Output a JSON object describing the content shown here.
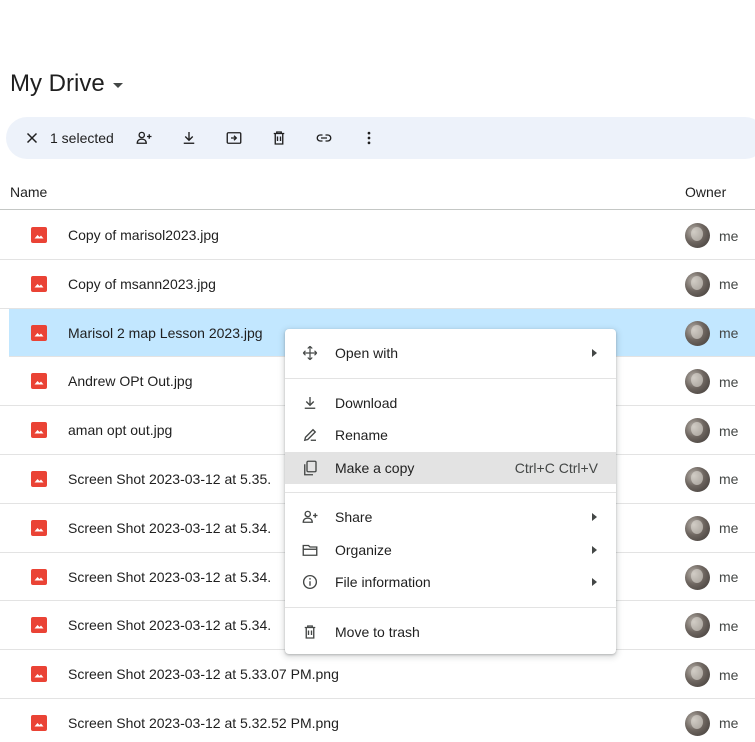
{
  "header": {
    "title": "My Drive"
  },
  "toolbar": {
    "selected_label": "1 selected"
  },
  "columns": {
    "name": "Name",
    "owner": "Owner"
  },
  "files": [
    {
      "name": "Copy of marisol2023.jpg",
      "owner": "me",
      "selected": false
    },
    {
      "name": "Copy of msann2023.jpg",
      "owner": "me",
      "selected": false
    },
    {
      "name": "Marisol 2 map Lesson 2023.jpg",
      "owner": "me",
      "selected": true
    },
    {
      "name": "Andrew OPt Out.jpg",
      "owner": "me",
      "selected": false
    },
    {
      "name": "aman opt out.jpg",
      "owner": "me",
      "selected": false
    },
    {
      "name": "Screen Shot 2023-03-12 at 5.35.",
      "owner": "me",
      "selected": false
    },
    {
      "name": "Screen Shot 2023-03-12 at 5.34.",
      "owner": "me",
      "selected": false
    },
    {
      "name": "Screen Shot 2023-03-12 at 5.34.",
      "owner": "me",
      "selected": false
    },
    {
      "name": "Screen Shot 2023-03-12 at 5.34.",
      "owner": "me",
      "selected": false
    },
    {
      "name": "Screen Shot 2023-03-12 at 5.33.07 PM.png",
      "owner": "me",
      "selected": false
    },
    {
      "name": "Screen Shot 2023-03-12 at 5.32.52 PM.png",
      "owner": "me",
      "selected": false
    }
  ],
  "context_menu": {
    "open_with": "Open with",
    "download": "Download",
    "rename": "Rename",
    "make_copy": "Make a copy",
    "make_copy_shortcut": "Ctrl+C Ctrl+V",
    "share": "Share",
    "organize": "Organize",
    "file_information": "File information",
    "move_to_trash": "Move to trash"
  },
  "colors": {
    "accent_selected": "#c2e7ff",
    "image_icon": "#ea4335",
    "toolbar_bg": "#edf2fa"
  }
}
